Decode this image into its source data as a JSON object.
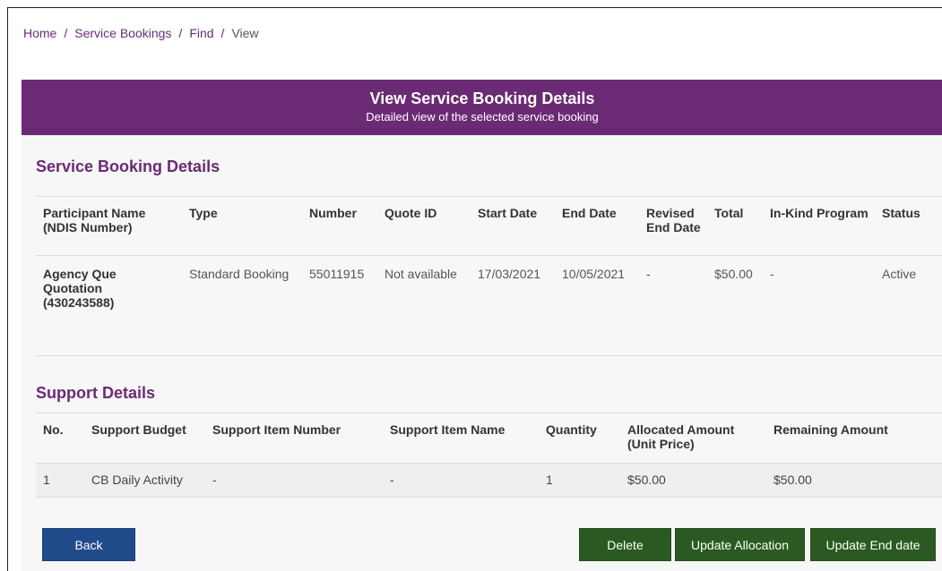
{
  "breadcrumb": {
    "items": [
      "Home",
      "Service Bookings",
      "Find",
      "View"
    ],
    "separator": "/"
  },
  "banner": {
    "title": "View Service Booking Details",
    "subtitle": "Detailed view of the selected service booking"
  },
  "booking_section": {
    "title": "Service Booking Details",
    "headers": {
      "participant": "Participant Name (NDIS Number)",
      "type": "Type",
      "number": "Number",
      "quote_id": "Quote ID",
      "start_date": "Start Date",
      "end_date": "End Date",
      "revised_end_date": "Revised End Date",
      "total": "Total",
      "in_kind": "In-Kind Program",
      "status": "Status"
    },
    "row": {
      "participant_name": "Agency Que Quotation",
      "ndis_number": "(430243588)",
      "type": "Standard Booking",
      "number": "55011915",
      "quote_id": "Not available",
      "start_date": "17/03/2021",
      "end_date": "10/05/2021",
      "revised_end_date": "-",
      "total": "$50.00",
      "in_kind": "-",
      "status": "Active"
    }
  },
  "support_section": {
    "title": "Support Details",
    "headers": {
      "no": "No.",
      "budget": "Support Budget",
      "item_number": "Support Item Number",
      "item_name": "Support Item Name",
      "quantity": "Quantity",
      "allocated": "Allocated Amount (Unit Price)",
      "remaining": "Remaining Amount"
    },
    "rows": [
      {
        "no": "1",
        "budget": "CB Daily Activity",
        "item_number": "-",
        "item_name": "-",
        "quantity": "1",
        "allocated": "$50.00",
        "remaining": "$50.00"
      }
    ]
  },
  "buttons": {
    "back": "Back",
    "delete": "Delete",
    "update_allocation": "Update Allocation",
    "update_end_date": "Update End date"
  },
  "colors": {
    "banner": "#6b2a74",
    "section_title": "#6b2a74",
    "back_button": "#1f4b8a",
    "action_buttons": "#2a5a22"
  }
}
